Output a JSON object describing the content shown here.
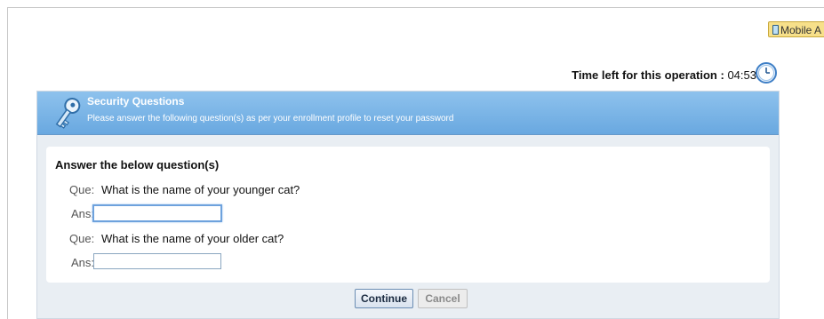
{
  "top_bar": {
    "mobile_label": "Mobile A"
  },
  "timer": {
    "label": "Time left for this operation :",
    "value": "04:53"
  },
  "panel": {
    "title": "Security Questions",
    "subtitle": "Please answer the following question(s) as per your enrollment profile to reset your password"
  },
  "form": {
    "heading": "Answer the below question(s)",
    "que_label": "Que:",
    "ans_label": "Ans:",
    "questions": [
      {
        "text": "What is the name of your younger cat?",
        "answer": ""
      },
      {
        "text": "What is the name of your older cat?",
        "answer": ""
      }
    ]
  },
  "buttons": {
    "continue": "Continue",
    "cancel": "Cancel"
  },
  "colors": {
    "header_blue": "#69a8e0",
    "panel_bg": "#e9eef3",
    "mobile_btn": "#f7e08a"
  }
}
